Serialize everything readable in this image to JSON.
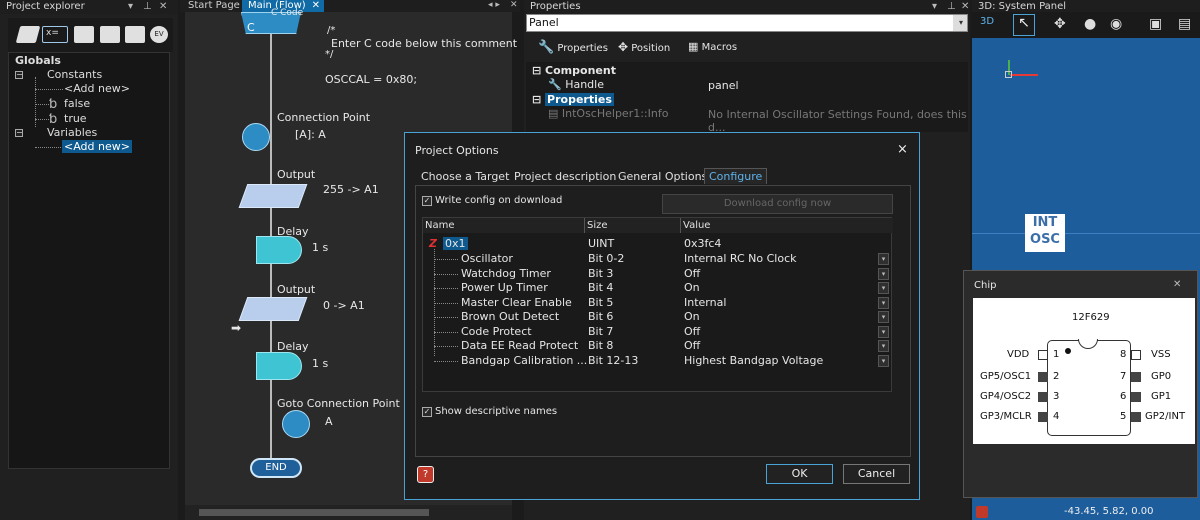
{
  "project_explorer": {
    "title": "Project explorer",
    "tree": {
      "root": "Globals",
      "constants_label": "Constants",
      "constants_add": "<Add new>",
      "const_false": "false",
      "const_true": "true",
      "variables_label": "Variables",
      "variables_add": "<Add new>"
    },
    "toolbar_ev": "EV"
  },
  "tabs": {
    "start_page": "Start Page",
    "main_flow": "Main (Flow)"
  },
  "flow": {
    "c_code_header": "C Code",
    "c_icon_letter": "C",
    "c_comment_1": "/*",
    "c_comment_2": "Enter C code below this comment",
    "c_comment_3": "*/",
    "c_code_line": "OSCCAL = 0x80;",
    "connection_label": "Connection Point",
    "connection_value": "[A]: A",
    "output1_label": "Output",
    "output1_value": "255 -> A1",
    "delay1_label": "Delay",
    "delay1_value": "1 s",
    "output2_label": "Output",
    "output2_value": "0 -> A1",
    "delay2_label": "Delay",
    "delay2_value": "1 s",
    "goto_label": "Goto Connection Point",
    "goto_value": "A",
    "end_label": "END"
  },
  "properties": {
    "title": "Properties",
    "combo_value": "Panel",
    "btn_properties": "Properties",
    "btn_position": "Position",
    "btn_macros": "Macros",
    "section_component": "Component",
    "handle_label": "Handle",
    "handle_value": "panel",
    "section_properties": "Properties",
    "info_label": "IntOscHelper1::Info",
    "info_value": "No Internal Oscillator Settings Found, does this d..."
  },
  "panel3d": {
    "title": "3D: System Panel",
    "tag_3d": "3D",
    "int_label": "INT",
    "osc_label": "OSC",
    "coords": "-43.45, 5.82, 0.00"
  },
  "chip": {
    "title": "Chip",
    "part": "12F629",
    "left_pins": [
      {
        "name": "VDD",
        "num": "1"
      },
      {
        "name": "GP5/OSC1",
        "num": "2"
      },
      {
        "name": "GP4/OSC2",
        "num": "3"
      },
      {
        "name": "GP3/MCLR",
        "num": "4"
      }
    ],
    "right_pins": [
      {
        "name": "VSS",
        "num": "8"
      },
      {
        "name": "GP0",
        "num": "7"
      },
      {
        "name": "GP1",
        "num": "6"
      },
      {
        "name": "GP2/INT",
        "num": "5"
      }
    ]
  },
  "dialog": {
    "title": "Project Options",
    "tabs": [
      "Choose a Target",
      "Project description",
      "General Options",
      "Configure"
    ],
    "write_config": "Write config on download",
    "download_btn": "Download config now",
    "columns": [
      "Name",
      "Size",
      "Value"
    ],
    "root_row": {
      "name": "0x1",
      "size": "UINT",
      "value": "0x3fc4"
    },
    "rows": [
      {
        "name": "Oscillator",
        "size": "Bit 0-2",
        "value": "Internal RC No Clock"
      },
      {
        "name": "Watchdog Timer",
        "size": "Bit 3",
        "value": "Off"
      },
      {
        "name": "Power Up Timer",
        "size": "Bit 4",
        "value": "On"
      },
      {
        "name": "Master Clear Enable",
        "size": "Bit 5",
        "value": "Internal"
      },
      {
        "name": "Brown Out Detect",
        "size": "Bit 6",
        "value": "On"
      },
      {
        "name": "Code Protect",
        "size": "Bit 7",
        "value": "Off"
      },
      {
        "name": "Data EE Read Protect",
        "size": "Bit 8",
        "value": "Off"
      },
      {
        "name": "Bandgap Calibration ...",
        "size": "Bit 12-13",
        "value": "Highest Bandgap Voltage"
      }
    ],
    "show_names": "Show descriptive names",
    "ok": "OK",
    "cancel": "Cancel",
    "close": "×"
  }
}
